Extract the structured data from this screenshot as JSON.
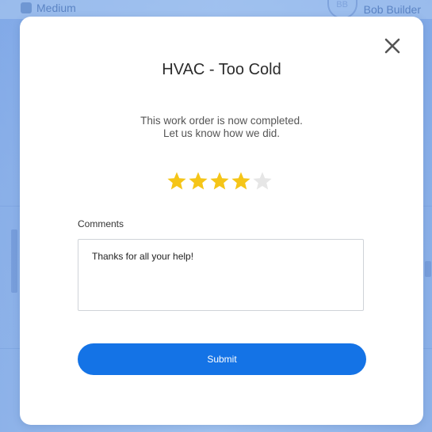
{
  "background": {
    "left_label": "Medium",
    "avatar_initials": "BB",
    "assignee": "Bob Builder"
  },
  "modal": {
    "title": "HVAC - Too Cold",
    "message_line1": "This work order is now completed.",
    "message_line2": "Let us know how we did.",
    "rating": {
      "value": 4,
      "max": 5,
      "filled_color": "#f5c518",
      "empty_color": "#e6e6e6"
    },
    "comments": {
      "label": "Comments",
      "value": "Thanks for all your help!"
    },
    "submit_label": "Submit",
    "close_icon": "close-icon"
  },
  "colors": {
    "accent": "#1473e6",
    "overlay": "#9ec1f1"
  }
}
